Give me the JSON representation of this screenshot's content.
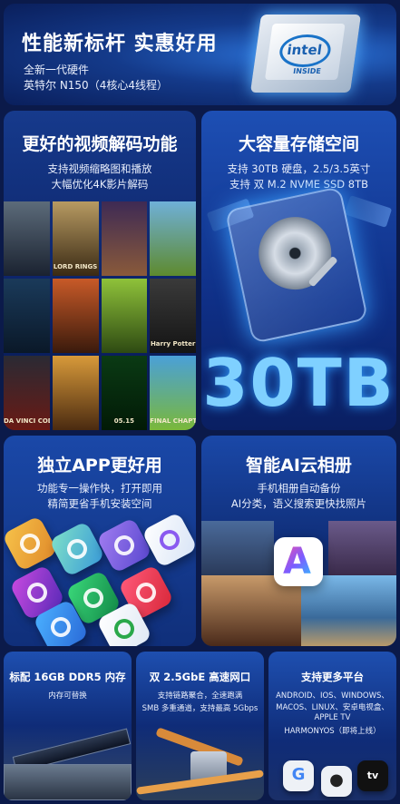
{
  "hero": {
    "title": "性能新标杆 实惠好用",
    "line1": "全新一代硬件",
    "line2": "英特尔 N150（4核心4线程）",
    "chip_brand": "intel",
    "chip_sub": "INSIDE"
  },
  "video": {
    "title": "更好的视频解码功能",
    "line1": "支持视频缩略图和播放",
    "line2": "大幅优化4K影片解码",
    "posters": [
      "",
      "LORD RINGS",
      "",
      "",
      "",
      "",
      "",
      "Harry Potter",
      "DA VINCI CODE",
      "",
      "05.15",
      "FINAL CHAPTER"
    ]
  },
  "storage": {
    "title": "大容量存储空间",
    "line1": "支持 30TB 硬盘，2.5/3.5英寸",
    "line2": "支持 双 M.2 NVME SSD 8TB",
    "big": "30TB"
  },
  "apps": {
    "title": "独立APP更好用",
    "line1": "功能专一操作快，打开即用",
    "line2": "精简更省手机安装空间"
  },
  "ai": {
    "title": "智能AI云相册",
    "line1": "手机相册自动备份",
    "line2": "AI分类，语义搜索更快找照片",
    "logo_letter": "A"
  },
  "ram": {
    "title": "标配 16GB DDR5 内存",
    "line1": "内存可替换"
  },
  "net": {
    "title": "双 2.5GbE 高速网口",
    "line1": "支持链路聚合，全速跑满",
    "line2": "SMB 多重通道，支持最高 5Gbps"
  },
  "platform": {
    "title": "支持更多平台",
    "line1": "ANDROID、IOS、WINDOWS、",
    "line2": "MACOS、LINUX、安卓电视盒、",
    "line3": "APPLE TV",
    "line4": "HARMONYOS（即将上线）",
    "icons": [
      "G",
      "",
      "tv"
    ]
  }
}
